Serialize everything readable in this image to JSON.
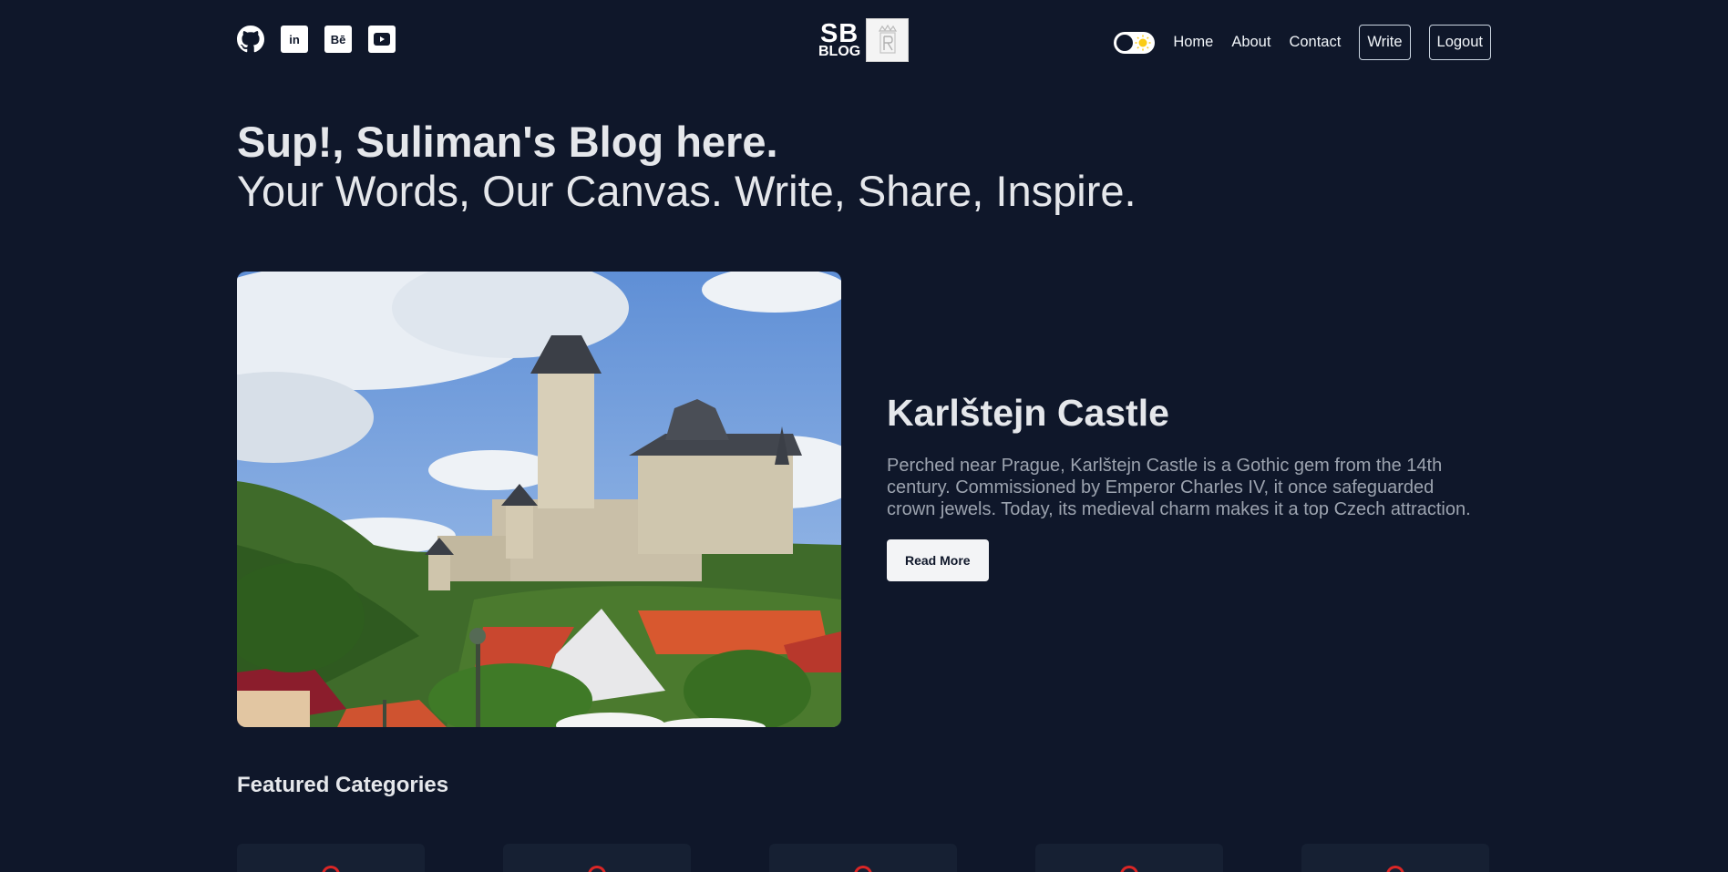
{
  "header": {
    "logo": {
      "line1": "SB",
      "line2": "BLOG"
    },
    "socials": [
      {
        "icon": "github-icon"
      },
      {
        "icon": "linkedin-icon",
        "glyph": "in"
      },
      {
        "icon": "behance-icon",
        "glyph": "Bē"
      },
      {
        "icon": "youtube-icon"
      }
    ],
    "nav": {
      "home": "Home",
      "about": "About",
      "contact": "Contact",
      "write": "Write",
      "logout": "Logout"
    }
  },
  "hero": {
    "title": "Sup!, Suliman's Blog here.",
    "subtitle": "Your Words, Our Canvas. Write, Share, Inspire."
  },
  "featured": {
    "title": "Karlštejn Castle",
    "description": "Perched near Prague, Karlštejn Castle is a Gothic gem from the 14th century. Commissioned by Emperor Charles IV, it once safeguarded crown jewels. Today, its medieval charm makes it a top Czech attraction.",
    "button": "Read More"
  },
  "categories": {
    "heading": "Featured Categories",
    "count": 5
  },
  "colors": {
    "background": "#0f172a",
    "card": "#162033",
    "accent": "#dc2626"
  }
}
